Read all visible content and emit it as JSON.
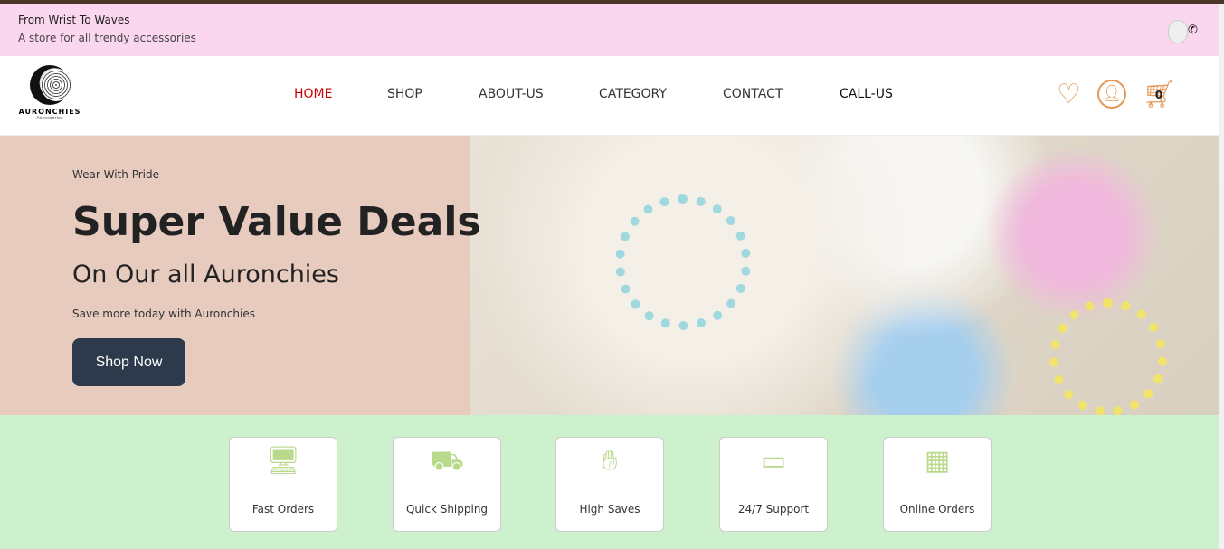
{
  "topbar": {
    "title": "From Wrist To Waves",
    "subtitle": "A store for all trendy accessories"
  },
  "logo": {
    "name": "AURONCHIES",
    "tagline": "Accessories"
  },
  "nav": {
    "items": [
      "HOME",
      "SHOP",
      "ABOUT-US",
      "CATEGORY",
      "CONTACT",
      "CALL-US"
    ],
    "active": "HOME"
  },
  "cart": {
    "count": "0"
  },
  "hero": {
    "kicker": "Wear With Pride",
    "title": "Super Value Deals",
    "subtitle": "On Our all Auronchies",
    "text": "Save more today with Auronchies",
    "button": "Shop Now"
  },
  "features": [
    "Fast Orders",
    "Quick Shipping",
    "High Saves",
    "24/7 Support",
    "Online Orders"
  ],
  "colors": {
    "accent": "#e29a5a",
    "topbar": "#fad7ef",
    "hero": "#e6cbbe",
    "features": "#cdf0cd",
    "button": "#2c3a4b"
  }
}
